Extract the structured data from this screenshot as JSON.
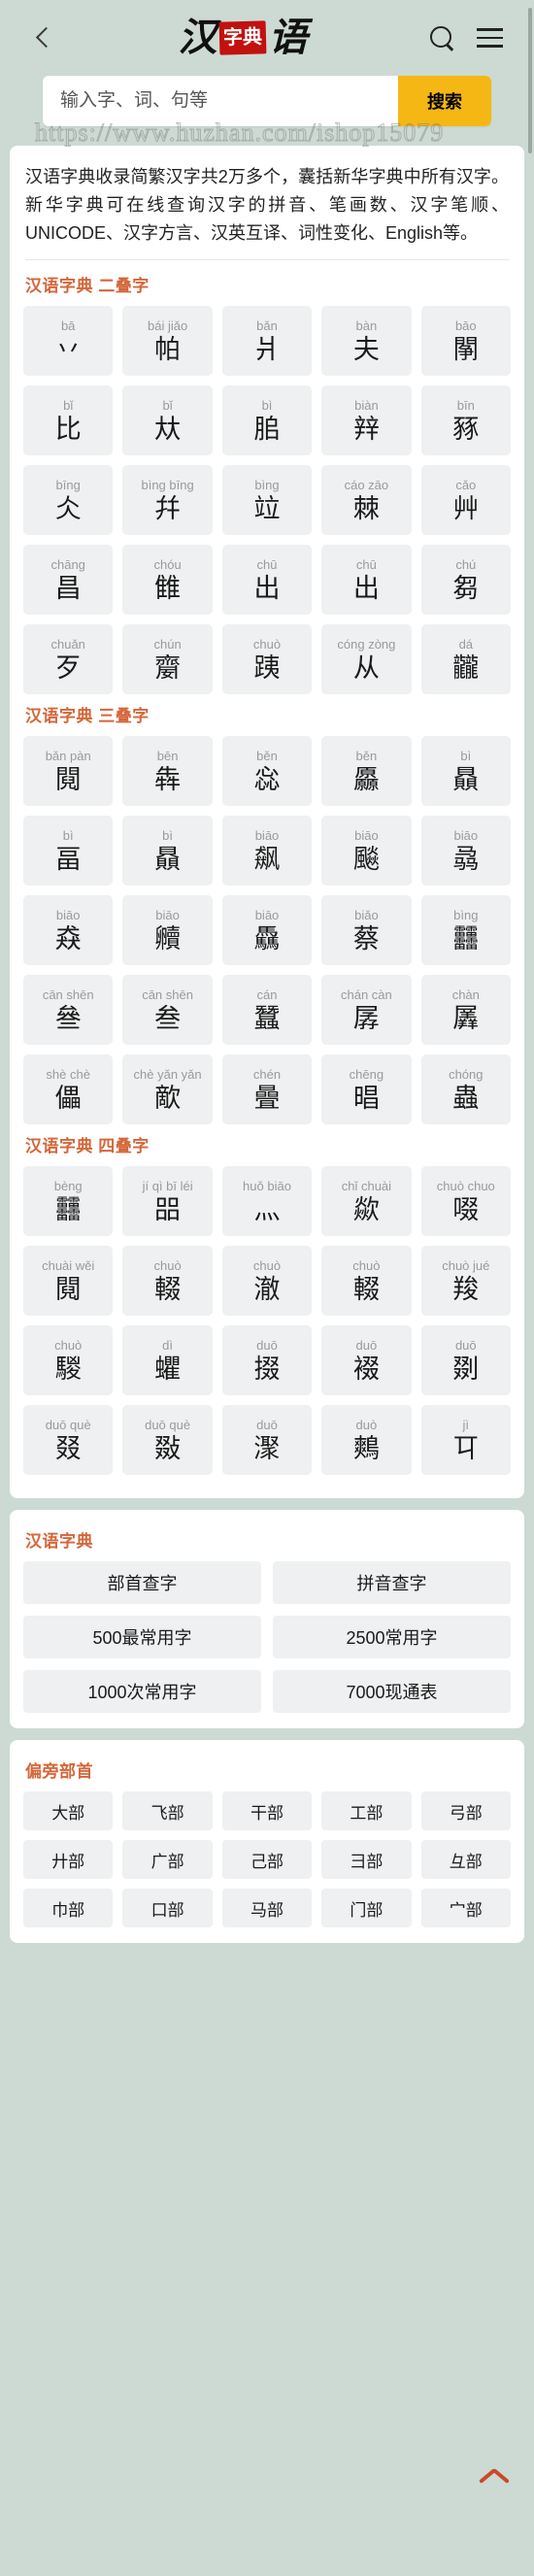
{
  "header": {
    "back_icon": "chevron-left-icon",
    "logo": {
      "left": "汉",
      "seal": "字典",
      "right": "语"
    },
    "search_icon": "search-icon",
    "menu_icon": "hamburger-menu-icon"
  },
  "search": {
    "placeholder": "输入字、词、句等",
    "value": "",
    "button_label": "搜索"
  },
  "watermark": "https://www.huzhan.com/ishop15079",
  "description": "汉语字典收录简繁汉字共2万多个，囊括新华字典中所有汉字。新华字典可在线查询汉字的拼音、笔画数、汉字笔顺、UNICODE、汉字方言、汉英互译、词性变化、English等。",
  "sections": [
    {
      "title": "汉语字典 二叠字",
      "items": [
        {
          "pinyin": "bā",
          "char": "丷"
        },
        {
          "pinyin": "bái jiǎo",
          "char": "帕"
        },
        {
          "pinyin": "bǎn",
          "char": "爿"
        },
        {
          "pinyin": "bàn",
          "char": "夫"
        },
        {
          "pinyin": "bāo",
          "char": "䦛"
        },
        {
          "pinyin": "bǐ",
          "char": "比"
        },
        {
          "pinyin": "bǐ",
          "char": "夶"
        },
        {
          "pinyin": "bì",
          "char": "䏨"
        },
        {
          "pinyin": "biàn",
          "char": "辡"
        },
        {
          "pinyin": "bīn",
          "char": "豩"
        },
        {
          "pinyin": "bīng",
          "char": "仌"
        },
        {
          "pinyin": "bìng bīng",
          "char": "幷"
        },
        {
          "pinyin": "bìng",
          "char": "竝"
        },
        {
          "pinyin": "cáo zāo",
          "char": "棘"
        },
        {
          "pinyin": "cǎo",
          "char": "艸"
        },
        {
          "pinyin": "chāng",
          "char": "昌"
        },
        {
          "pinyin": "chóu",
          "char": "雔"
        },
        {
          "pinyin": "chū",
          "char": "出"
        },
        {
          "pinyin": "chū",
          "char": "出"
        },
        {
          "pinyin": "chú",
          "char": "芻"
        },
        {
          "pinyin": "chuǎn",
          "char": "歹"
        },
        {
          "pinyin": "chún",
          "char": "䶒"
        },
        {
          "pinyin": "chuò",
          "char": "跠"
        },
        {
          "pinyin": "cóng zòng",
          "char": "从"
        },
        {
          "pinyin": "dá",
          "char": "龖"
        }
      ]
    },
    {
      "title": "汉语字典 三叠字",
      "items": [
        {
          "pinyin": "bǎn pàn",
          "char": "䦧"
        },
        {
          "pinyin": "bēn",
          "char": "犇"
        },
        {
          "pinyin": "běn",
          "char": "惢"
        },
        {
          "pinyin": "běn",
          "char": "厵"
        },
        {
          "pinyin": "bì",
          "char": "贔"
        },
        {
          "pinyin": "bì",
          "char": "畐"
        },
        {
          "pinyin": "bì",
          "char": "贔"
        },
        {
          "pinyin": "biāo",
          "char": "飙"
        },
        {
          "pinyin": "biāo",
          "char": "飈"
        },
        {
          "pinyin": "biāo",
          "char": "骉"
        },
        {
          "pinyin": "biāo",
          "char": "猋"
        },
        {
          "pinyin": "biāo",
          "char": "贕"
        },
        {
          "pinyin": "biāo",
          "char": "驫"
        },
        {
          "pinyin": "biǎo",
          "char": "蔡"
        },
        {
          "pinyin": "bìng",
          "char": "䨻"
        },
        {
          "pinyin": "cān shēn",
          "char": "叄"
        },
        {
          "pinyin": "cān shēn",
          "char": "叁"
        },
        {
          "pinyin": "cán",
          "char": "蠶"
        },
        {
          "pinyin": "chán càn",
          "char": "孱"
        },
        {
          "pinyin": "chàn",
          "char": "羼"
        },
        {
          "pinyin": "shè chè",
          "char": "儡"
        },
        {
          "pinyin": "chè yǎn yǎn",
          "char": "歒"
        },
        {
          "pinyin": "chén",
          "char": "曡"
        },
        {
          "pinyin": "chēng",
          "char": "晿"
        },
        {
          "pinyin": "chóng",
          "char": "蟲"
        }
      ]
    },
    {
      "title": "汉语字典 四叠字",
      "items": [
        {
          "pinyin": "bèng",
          "char": "䨻"
        },
        {
          "pinyin": "jí qì bī léi",
          "char": "㗊"
        },
        {
          "pinyin": "huǒ biāo",
          "char": "灬"
        },
        {
          "pinyin": "chǐ chuài",
          "char": "歘"
        },
        {
          "pinyin": "chuò chuo",
          "char": "啜"
        },
        {
          "pinyin": "chuài wěi",
          "char": "䦧"
        },
        {
          "pinyin": "chuò",
          "char": "輟"
        },
        {
          "pinyin": "chuò",
          "char": "澈"
        },
        {
          "pinyin": "chuò",
          "char": "輟"
        },
        {
          "pinyin": "chuò jué",
          "char": "羧"
        },
        {
          "pinyin": "chuò",
          "char": "騣"
        },
        {
          "pinyin": "dì",
          "char": "蠷"
        },
        {
          "pinyin": "duō",
          "char": "掇"
        },
        {
          "pinyin": "duō",
          "char": "裰"
        },
        {
          "pinyin": "duō",
          "char": "剟"
        },
        {
          "pinyin": "duō què",
          "char": "叕"
        },
        {
          "pinyin": "duō què",
          "char": "敠"
        },
        {
          "pinyin": "duō",
          "char": "㵵"
        },
        {
          "pinyin": "duò",
          "char": "鷞"
        },
        {
          "pinyin": "jì",
          "char": "㔿"
        }
      ]
    }
  ],
  "dict_panel": {
    "title": "汉语字典",
    "buttons": [
      "部首查字",
      "拼音查字",
      "500最常用字",
      "2500常用字",
      "1000次常用字",
      "7000现通表"
    ]
  },
  "radical_panel": {
    "title": "偏旁部首",
    "items": [
      "大部",
      "飞部",
      "干部",
      "工部",
      "弓部",
      "廾部",
      "广部",
      "己部",
      "彐部",
      "彑部",
      "巾部",
      "口部",
      "马部",
      "门部",
      "宀部"
    ]
  },
  "back_to_top_icon": "chevron-up-icon"
}
